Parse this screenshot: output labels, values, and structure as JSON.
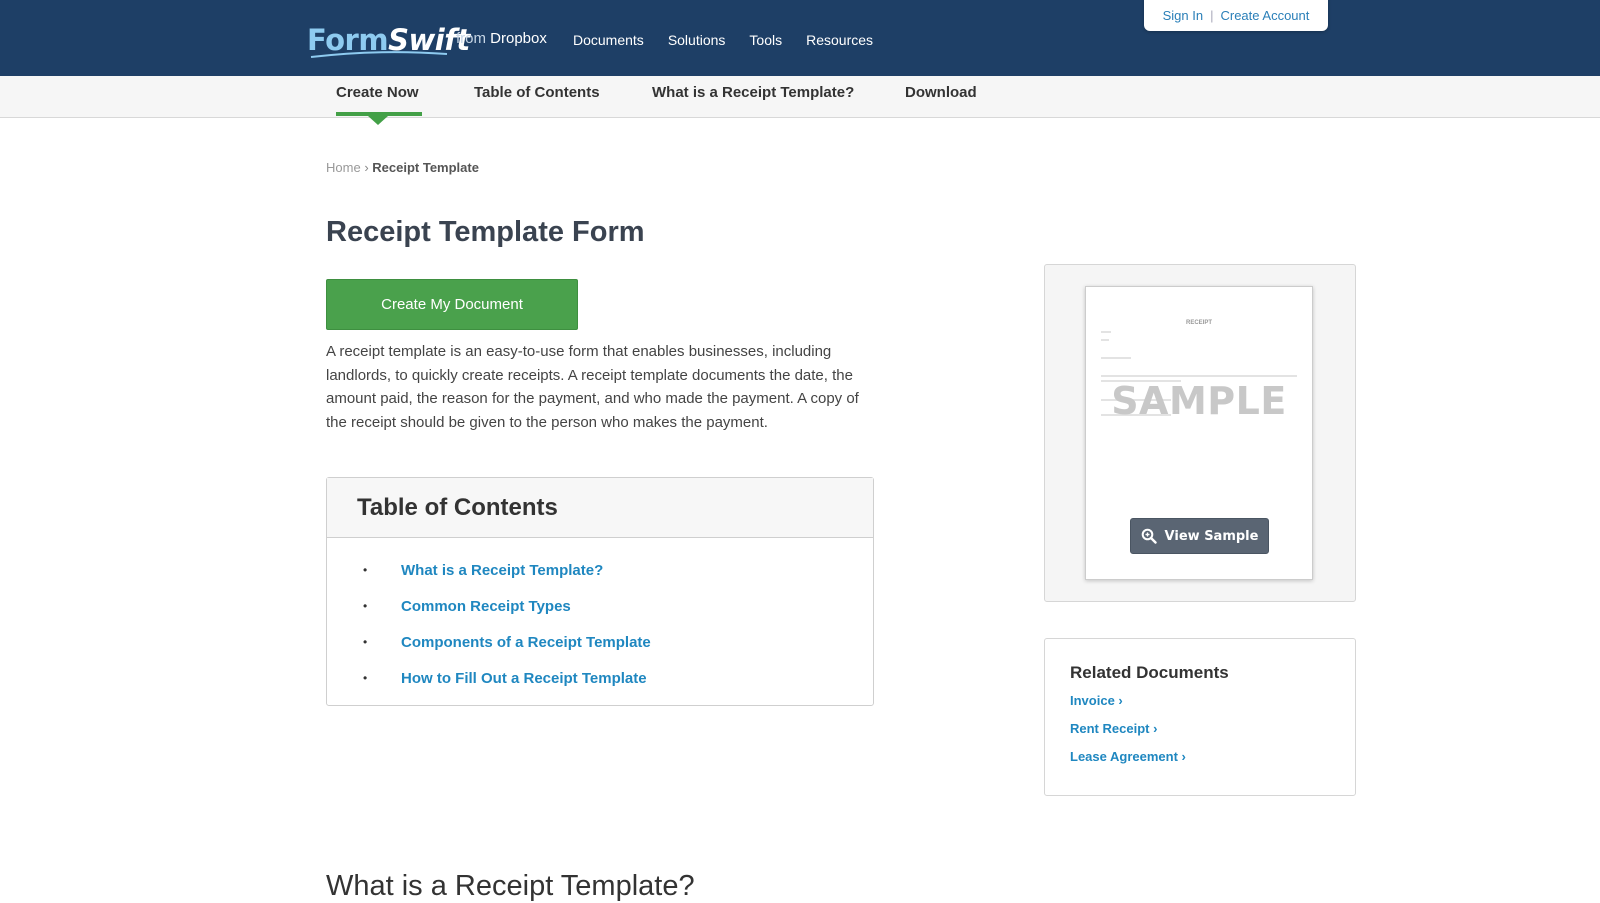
{
  "header": {
    "logo_form": "Form",
    "logo_swift": "Swift",
    "from_text": "from",
    "from_brand": "Dropbox",
    "nav": [
      "Documents",
      "Solutions",
      "Tools",
      "Resources"
    ],
    "sign_in": "Sign In",
    "separator": "|",
    "create_account": "Create Account"
  },
  "subnav": {
    "items": [
      "Create Now",
      "Table of Contents",
      "What is a Receipt Template?",
      "Download"
    ],
    "active_index": 0
  },
  "breadcrumb": {
    "home": "Home",
    "sep": "›",
    "current": "Receipt Template"
  },
  "main": {
    "title": "Receipt Template Form",
    "cta_label": "Create My Document",
    "intro": "A receipt template is an easy-to-use form that enables businesses, including landlords, to quickly create receipts. A receipt template documents the date, the amount paid, the reason for the payment, and who made the payment. A copy of the receipt should be given to the person who makes the payment.",
    "toc": {
      "heading": "Table of Contents",
      "bullet": "•",
      "items": [
        "What is a Receipt Template?",
        "Common Receipt Types",
        "Components of a Receipt Template",
        "How to Fill Out a Receipt Template"
      ]
    },
    "section_heading": "What is a Receipt Template?"
  },
  "sidebar": {
    "sample": {
      "doc_title": "RECEIPT",
      "watermark": "SAMPLE",
      "button_label": "View Sample"
    },
    "related": {
      "heading": "Related Documents",
      "links": [
        "Invoice ›",
        "Rent Receipt ›",
        "Lease Agreement ›"
      ]
    }
  },
  "colors": {
    "header_bg": "#1e3f66",
    "accent_green": "#4aa14c",
    "link_blue": "#1f87c0"
  }
}
